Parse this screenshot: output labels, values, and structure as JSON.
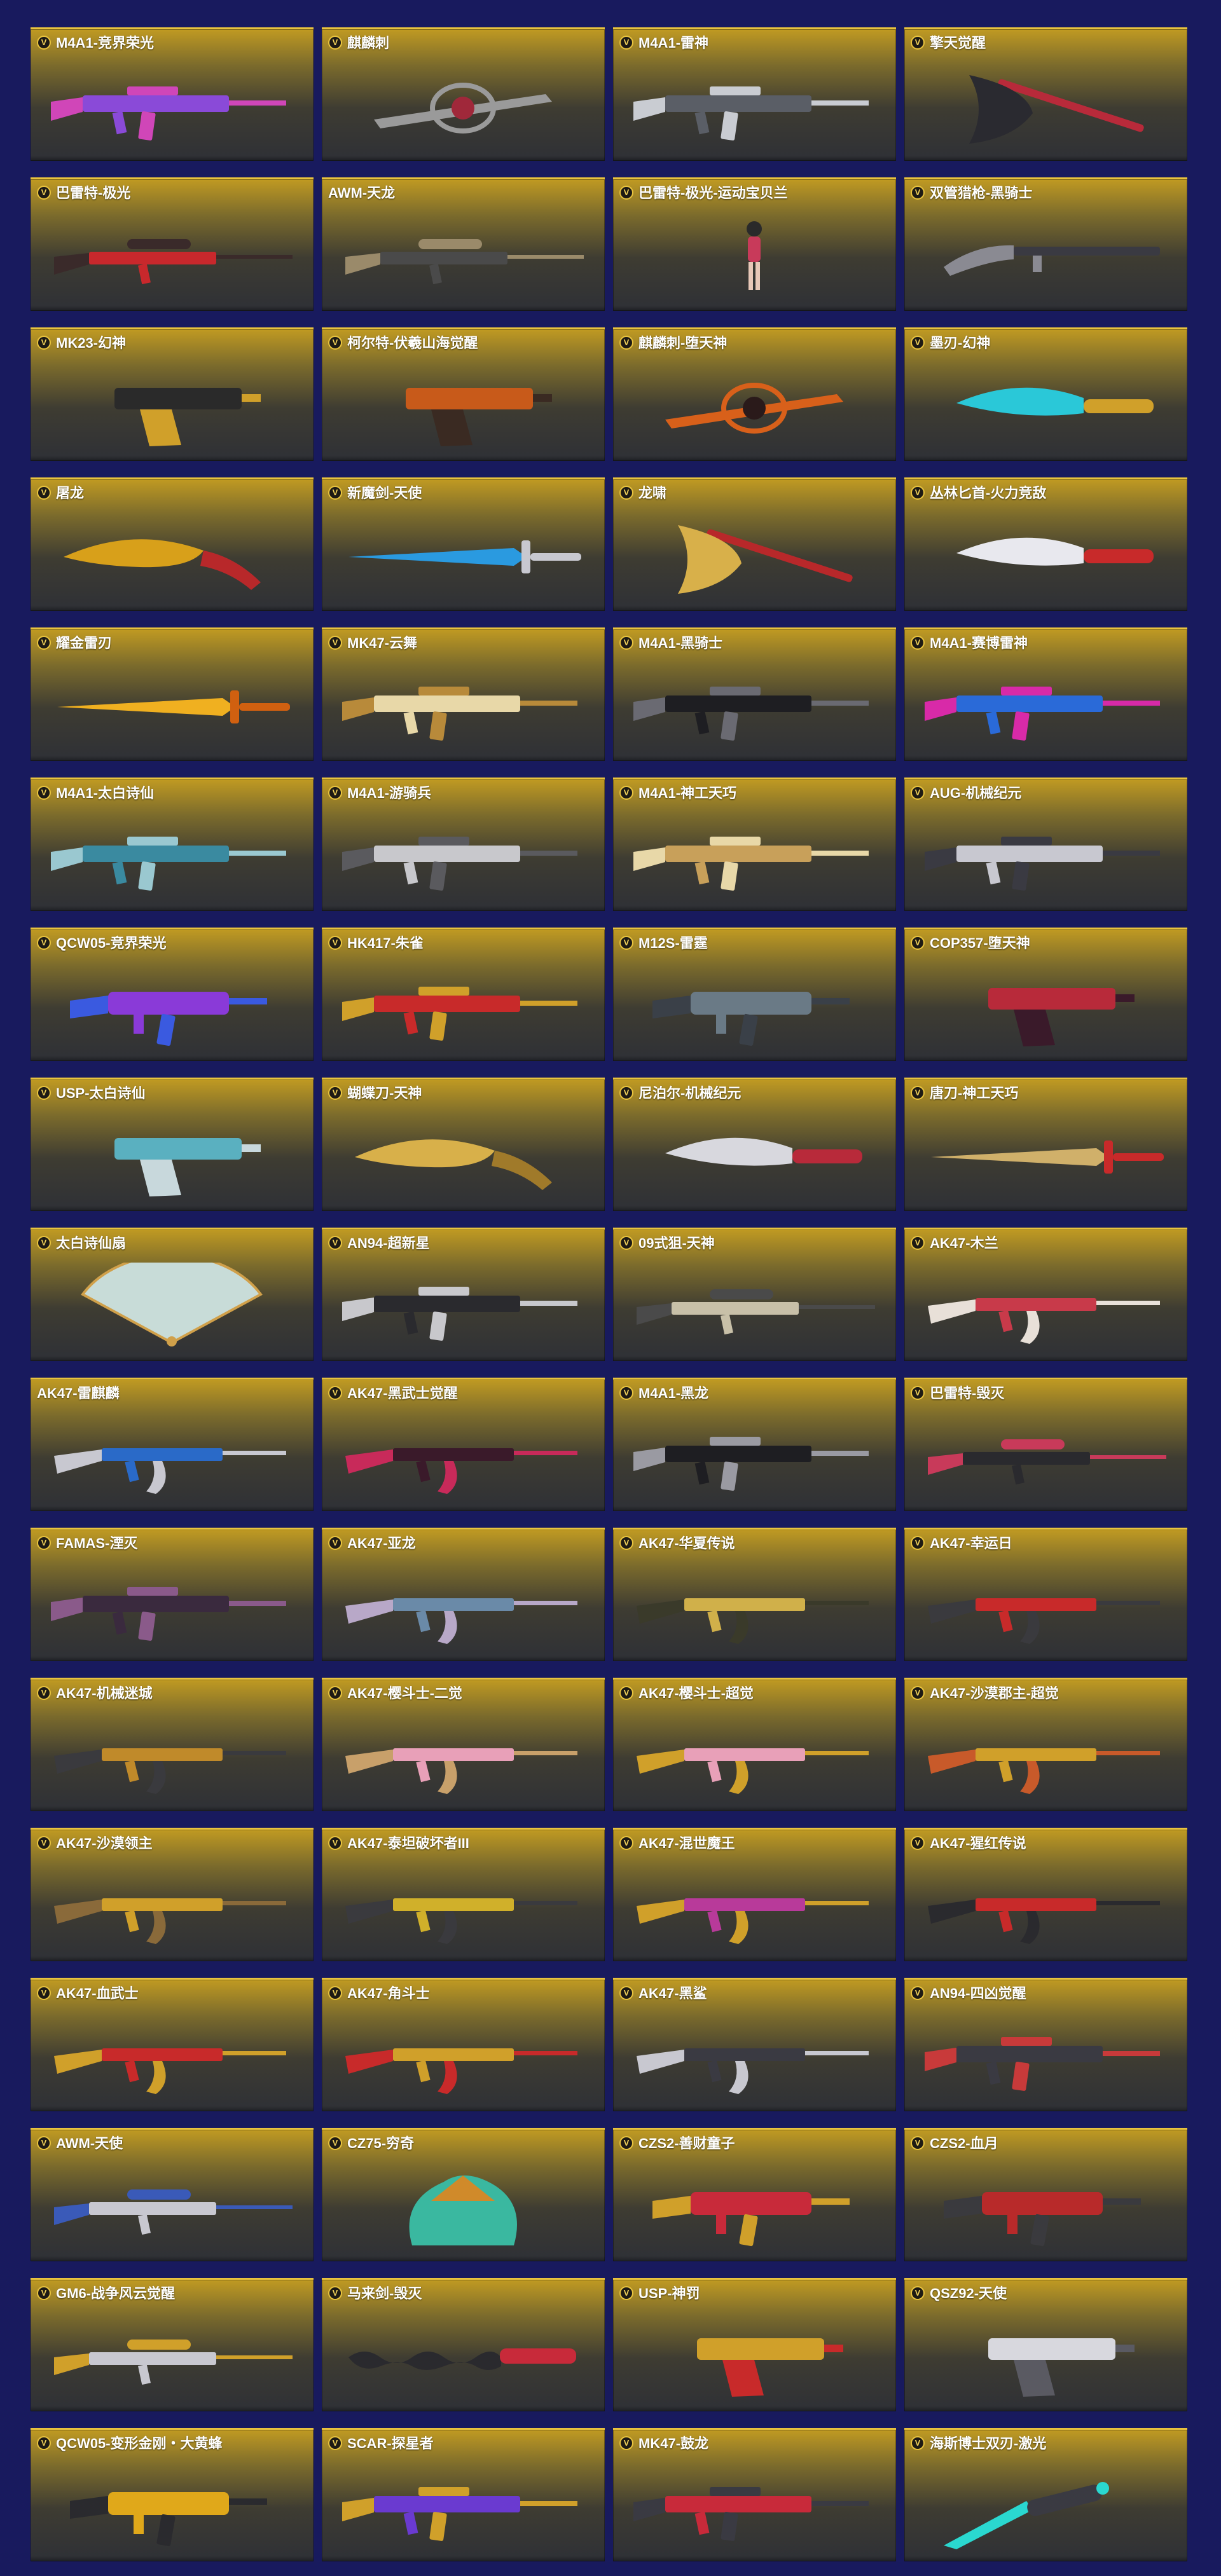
{
  "badge_letter": "V",
  "colors": {
    "page_background": "#181a5e",
    "card_top": "#c09a22",
    "card_bottom": "#2e3036",
    "card_border": "#e8c33e"
  },
  "items": [
    {
      "name": "M4A1-竞界荣光",
      "badge": true,
      "icon": "rifle-icon",
      "colors": [
        "#8a4ad8",
        "#d046b8"
      ]
    },
    {
      "name": "麒麟刺",
      "badge": true,
      "icon": "ornate-blade-icon",
      "colors": [
        "#9a9a9a",
        "#a0283a"
      ]
    },
    {
      "name": "M4A1-雷神",
      "badge": true,
      "icon": "rifle-icon",
      "colors": [
        "#5a5e66",
        "#c9ccd2"
      ]
    },
    {
      "name": "擎天觉醒",
      "badge": true,
      "icon": "axe-icon",
      "colors": [
        "#2a2a30",
        "#b82a3a"
      ]
    },
    {
      "name": "巴雷特-极光",
      "badge": true,
      "icon": "sniper-icon",
      "colors": [
        "#c8282c",
        "#3a2a2a"
      ]
    },
    {
      "name": "AWM-天龙",
      "badge": false,
      "icon": "sniper-icon",
      "colors": [
        "#4a4a4a",
        "#9a8a6a"
      ]
    },
    {
      "name": "巴雷特-极光-运动宝贝兰",
      "badge": true,
      "icon": "character-icon",
      "colors": [
        "#c83a5a",
        "#2a2a2a"
      ]
    },
    {
      "name": "双管猎枪-黑骑士",
      "badge": true,
      "icon": "shotgun-icon",
      "colors": [
        "#3a3a42",
        "#8a8a92"
      ]
    },
    {
      "name": "MK23-幻神",
      "badge": true,
      "icon": "pistol-icon",
      "colors": [
        "#2a2a2a",
        "#d0a02a"
      ]
    },
    {
      "name": "柯尔特-伏羲山海觉醒",
      "badge": true,
      "icon": "pistol-icon",
      "colors": [
        "#c85a1a",
        "#3a2a22"
      ]
    },
    {
      "name": "麒麟刺-堕天神",
      "badge": true,
      "icon": "ornate-blade-icon",
      "colors": [
        "#d8601a",
        "#2a1a1a"
      ]
    },
    {
      "name": "墨刃-幻神",
      "badge": true,
      "icon": "knife-icon",
      "colors": [
        "#2ac8d8",
        "#d0a02a"
      ]
    },
    {
      "name": "屠龙",
      "badge": true,
      "icon": "kukri-icon",
      "colors": [
        "#d8a01a",
        "#b8282a"
      ]
    },
    {
      "name": "新魔剑-天使",
      "badge": true,
      "icon": "sword-icon",
      "colors": [
        "#2a9ae0",
        "#c8c8d0"
      ]
    },
    {
      "name": "龙啸",
      "badge": true,
      "icon": "axe-icon",
      "colors": [
        "#d8b04a",
        "#b8282a"
      ]
    },
    {
      "name": "丛林匕首-火力竞敌",
      "badge": true,
      "icon": "knife-icon",
      "colors": [
        "#e8e8ee",
        "#c82a2a"
      ]
    },
    {
      "name": "耀金雷刃",
      "badge": true,
      "icon": "sword-icon",
      "colors": [
        "#f0b020",
        "#d06010"
      ]
    },
    {
      "name": "MK47-云舞",
      "badge": true,
      "icon": "rifle-icon",
      "colors": [
        "#e8d8a8",
        "#b88a3a"
      ]
    },
    {
      "name": "M4A1-黑骑士",
      "badge": true,
      "icon": "rifle-icon",
      "colors": [
        "#1e1e22",
        "#6a6a72"
      ]
    },
    {
      "name": "M4A1-赛博雷神",
      "badge": true,
      "icon": "rifle-icon",
      "colors": [
        "#2a6ad8",
        "#d82aa8"
      ]
    },
    {
      "name": "M4A1-太白诗仙",
      "badge": true,
      "icon": "rifle-icon",
      "colors": [
        "#3a8aa0",
        "#9ac8d0"
      ]
    },
    {
      "name": "M4A1-游骑兵",
      "badge": true,
      "icon": "rifle-icon",
      "colors": [
        "#c8c8cc",
        "#5a5a5e"
      ]
    },
    {
      "name": "M4A1-神工天巧",
      "badge": true,
      "icon": "rifle-icon",
      "colors": [
        "#c8a05a",
        "#e8d8a8"
      ]
    },
    {
      "name": "AUG-机械纪元",
      "badge": true,
      "icon": "rifle-icon",
      "colors": [
        "#c8c8d0",
        "#3a3a42"
      ]
    },
    {
      "name": "QCW05-竞界荣光",
      "badge": true,
      "icon": "smg-icon",
      "colors": [
        "#8a3ad8",
        "#3a5ae0"
      ]
    },
    {
      "name": "HK417-朱雀",
      "badge": true,
      "icon": "rifle-icon",
      "colors": [
        "#c82a2a",
        "#d0a02a"
      ]
    },
    {
      "name": "M12S-雷霆",
      "badge": true,
      "icon": "smg-icon",
      "colors": [
        "#6a7a86",
        "#3a4048"
      ]
    },
    {
      "name": "COP357-堕天神",
      "badge": true,
      "icon": "pistol-icon",
      "colors": [
        "#b82a3a",
        "#3a1a2a"
      ]
    },
    {
      "name": "USP-太白诗仙",
      "badge": true,
      "icon": "pistol-icon",
      "colors": [
        "#5ab0c0",
        "#c8d8dc"
      ]
    },
    {
      "name": "蝴蝶刀-天神",
      "badge": true,
      "icon": "kukri-icon",
      "colors": [
        "#d8b04a",
        "#a07a2a"
      ]
    },
    {
      "name": "尼泊尔-机械纪元",
      "badge": true,
      "icon": "knife-icon",
      "colors": [
        "#d8d8de",
        "#b82a3a"
      ]
    },
    {
      "name": "唐刀-神工天巧",
      "badge": true,
      "icon": "sword-icon",
      "colors": [
        "#d0b06a",
        "#c82a2a"
      ]
    },
    {
      "name": "太白诗仙扇",
      "badge": true,
      "icon": "fan-icon",
      "colors": [
        "#c8dcd8",
        "#d0a04a"
      ]
    },
    {
      "name": "AN94-超新星",
      "badge": true,
      "icon": "rifle-icon",
      "colors": [
        "#2a2a2e",
        "#c8c8cc"
      ]
    },
    {
      "name": "09式狙-天神",
      "badge": true,
      "icon": "sniper-icon",
      "colors": [
        "#c8c0a8",
        "#4a4a4a"
      ]
    },
    {
      "name": "AK47-木兰",
      "badge": true,
      "icon": "ak-icon",
      "colors": [
        "#c83a4a",
        "#e8e0d8"
      ]
    },
    {
      "name": "AK47-雷麒麟",
      "badge": false,
      "icon": "ak-icon",
      "colors": [
        "#2a6ac8",
        "#c8c8d0"
      ]
    },
    {
      "name": "AK47-黑武士觉醒",
      "badge": true,
      "icon": "ak-icon",
      "colors": [
        "#3a1a2a",
        "#c82a5a"
      ]
    },
    {
      "name": "M4A1-黑龙",
      "badge": true,
      "icon": "rifle-icon",
      "colors": [
        "#1e1e22",
        "#9a9aa2"
      ]
    },
    {
      "name": "巴雷特-毁灭",
      "badge": true,
      "icon": "sniper-icon",
      "colors": [
        "#2a2a2e",
        "#c83a5a"
      ]
    },
    {
      "name": "FAMAS-湮灭",
      "badge": true,
      "icon": "rifle-icon",
      "colors": [
        "#3a2a3e",
        "#8a5a8a"
      ]
    },
    {
      "name": "AK47-亚龙",
      "badge": true,
      "icon": "ak-icon",
      "colors": [
        "#6a8aa8",
        "#b8a8c8"
      ]
    },
    {
      "name": "AK47-华夏传说",
      "badge": true,
      "icon": "ak-icon",
      "colors": [
        "#d0b04a",
        "#3a3a2a"
      ]
    },
    {
      "name": "AK47-幸运日",
      "badge": true,
      "icon": "ak-icon",
      "colors": [
        "#c82a2a",
        "#3a3a3e"
      ]
    },
    {
      "name": "AK47-机械迷城",
      "badge": true,
      "icon": "ak-icon",
      "colors": [
        "#c08a2a",
        "#3a3a3e"
      ]
    },
    {
      "name": "AK47-樱斗士-二觉",
      "badge": true,
      "icon": "ak-icon",
      "colors": [
        "#e8a0b8",
        "#c8a06a"
      ]
    },
    {
      "name": "AK47-樱斗士-超觉",
      "badge": true,
      "icon": "ak-icon",
      "colors": [
        "#e8a0b8",
        "#d0a02a"
      ]
    },
    {
      "name": "AK47-沙漠郡主-超觉",
      "badge": true,
      "icon": "ak-icon",
      "colors": [
        "#d0a02a",
        "#c85a2a"
      ]
    },
    {
      "name": "AK47-沙漠领主",
      "badge": true,
      "icon": "ak-icon",
      "colors": [
        "#d0a02a",
        "#8a6a3a"
      ]
    },
    {
      "name": "AK47-泰坦破坏者III",
      "badge": true,
      "icon": "ak-icon",
      "colors": [
        "#d0b02a",
        "#3a3a3e"
      ]
    },
    {
      "name": "AK47-混世魔王",
      "badge": true,
      "icon": "ak-icon",
      "colors": [
        "#b83a9a",
        "#d0a02a"
      ]
    },
    {
      "name": "AK47-猩红传说",
      "badge": true,
      "icon": "ak-icon",
      "colors": [
        "#c82a2a",
        "#2a2a2e"
      ]
    },
    {
      "name": "AK47-血武士",
      "badge": true,
      "icon": "ak-icon",
      "colors": [
        "#c82a2a",
        "#d0a02a"
      ]
    },
    {
      "name": "AK47-角斗士",
      "badge": true,
      "icon": "ak-icon",
      "colors": [
        "#d0a02a",
        "#c82a2a"
      ]
    },
    {
      "name": "AK47-黑鲨",
      "badge": true,
      "icon": "ak-icon",
      "colors": [
        "#3a3a42",
        "#c8c8d0"
      ]
    },
    {
      "name": "AN94-四凶觉醒",
      "badge": true,
      "icon": "rifle-icon",
      "colors": [
        "#3a3a42",
        "#c83a3a"
      ]
    },
    {
      "name": "AWM-天使",
      "badge": true,
      "icon": "sniper-icon",
      "colors": [
        "#c8c8d0",
        "#3a5ab8"
      ]
    },
    {
      "name": "CZ75-穷奇",
      "badge": true,
      "icon": "creature-icon",
      "colors": [
        "#3ab8a0",
        "#d08a2a"
      ]
    },
    {
      "name": "CZS2-善财童子",
      "badge": true,
      "icon": "smg-icon",
      "colors": [
        "#c82a3a",
        "#d0a02a"
      ]
    },
    {
      "name": "CZS2-血月",
      "badge": true,
      "icon": "smg-icon",
      "colors": [
        "#b82a2a",
        "#3a3a3e"
      ]
    },
    {
      "name": "GM6-战争风云觉醒",
      "badge": true,
      "icon": "sniper-icon",
      "colors": [
        "#c8c8d0",
        "#d0a02a"
      ]
    },
    {
      "name": "马来剑-毁灭",
      "badge": true,
      "icon": "kris-icon",
      "colors": [
        "#2a2a2e",
        "#c82a3a"
      ]
    },
    {
      "name": "USP-神罚",
      "badge": true,
      "icon": "pistol-icon",
      "colors": [
        "#d0a02a",
        "#c82a2a"
      ]
    },
    {
      "name": "QSZ92-天使",
      "badge": true,
      "icon": "pistol-icon",
      "colors": [
        "#d8d8de",
        "#5a5a62"
      ]
    },
    {
      "name": "QCW05-变形金刚・大黄蜂",
      "badge": true,
      "icon": "smg-icon",
      "colors": [
        "#e0a81a",
        "#2a2a2e"
      ]
    },
    {
      "name": "SCAR-探星者",
      "badge": true,
      "icon": "rifle-icon",
      "colors": [
        "#6a3ad0",
        "#d0a02a"
      ]
    },
    {
      "name": "MK47-鼓龙",
      "badge": true,
      "icon": "rifle-icon",
      "colors": [
        "#c82a3a",
        "#3a3a42"
      ]
    },
    {
      "name": "海斯博士双刃-激光",
      "badge": true,
      "icon": "laser-blade-icon",
      "colors": [
        "#2ad8d0",
        "#3a3a42"
      ]
    }
  ]
}
